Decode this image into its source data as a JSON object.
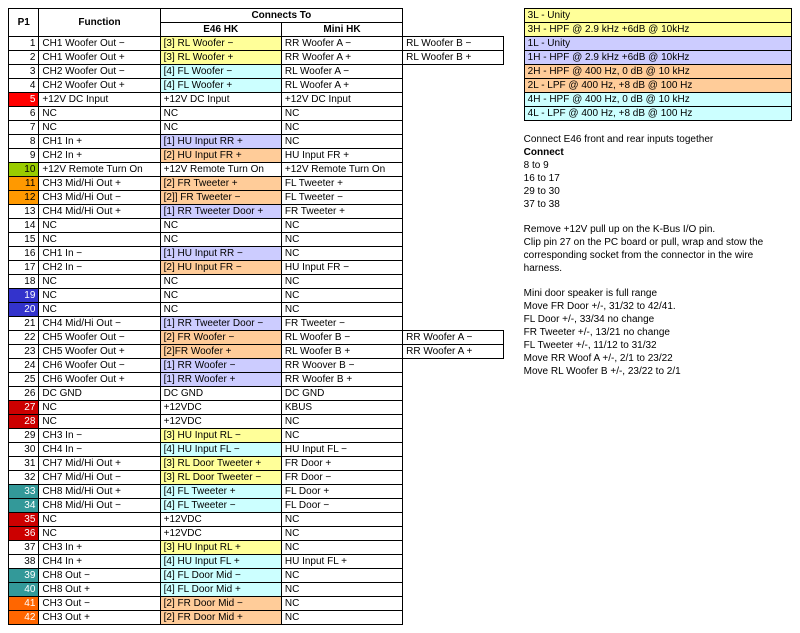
{
  "headers": {
    "p1": "P1",
    "fn": "Function",
    "ct": "Connects To",
    "e46": "E46 HK",
    "mini": "Mini HK"
  },
  "rows": [
    {
      "n": "1",
      "nc": "c-none",
      "fn": "CH1 Woofer Out −",
      "e46": "[3] RL Woofer −",
      "e46c": "c-yel",
      "mini": "RR Woofer A −",
      "ex": "RL Woofer B −"
    },
    {
      "n": "2",
      "nc": "c-none",
      "fn": "CH1 Woofer Out +",
      "e46": "[3] RL Woofer +",
      "e46c": "c-yel",
      "mini": "RR Woofer A +",
      "ex": "RL Woofer B +"
    },
    {
      "n": "3",
      "nc": "c-none",
      "fn": "CH2 Woofer Out −",
      "e46": "[4] FL Woofer −",
      "e46c": "c-cyan",
      "mini": "RL Woofer A −"
    },
    {
      "n": "4",
      "nc": "c-none",
      "fn": "CH2 Woofer Out +",
      "e46": "[4] FL Woofer +",
      "e46c": "c-cyan",
      "mini": "RL Woofer A +"
    },
    {
      "n": "5",
      "nc": "c-red",
      "fn": "+12V DC Input",
      "e46": "+12V DC Input",
      "mini": "+12V DC Input"
    },
    {
      "n": "6",
      "nc": "c-none",
      "fn": "NC",
      "e46": "NC",
      "mini": "NC"
    },
    {
      "n": "7",
      "nc": "c-none",
      "fn": "NC",
      "e46": "NC",
      "mini": "NC"
    },
    {
      "n": "8",
      "nc": "c-none",
      "fn": "CH1 In +",
      "e46": "[1] HU Input RR +",
      "e46c": "c-pur",
      "mini": "NC"
    },
    {
      "n": "9",
      "nc": "c-none",
      "fn": "CH2 In +",
      "e46": "[2] HU Input FR +",
      "e46c": "c-lora",
      "mini": "HU Input FR +"
    },
    {
      "n": "10",
      "nc": "c-grn",
      "fn": "+12V Remote Turn On",
      "e46": "+12V Remote Turn On",
      "mini": "+12V Remote Turn On"
    },
    {
      "n": "11",
      "nc": "c-ora",
      "fn": "CH3 Mid/Hi Out +",
      "e46": "[2] FR Tweeter +",
      "e46c": "c-lora",
      "mini": "FL Tweeter +"
    },
    {
      "n": "12",
      "nc": "c-ora",
      "fn": "CH3 Mid/Hi Out −",
      "e46": "[2]] FR Tweeter −",
      "e46c": "c-lora",
      "mini": "FL Tweeter −"
    },
    {
      "n": "13",
      "nc": "c-none",
      "fn": "CH4 Mid/Hi Out +",
      "e46": "[1] RR Tweeter Door +",
      "e46c": "c-pur",
      "mini": "FR Tweeter +"
    },
    {
      "n": "14",
      "nc": "c-none",
      "fn": "NC",
      "e46": "NC",
      "mini": "NC"
    },
    {
      "n": "15",
      "nc": "c-none",
      "fn": "NC",
      "e46": "NC",
      "mini": "NC"
    },
    {
      "n": "16",
      "nc": "c-none",
      "fn": "CH1 In −",
      "e46": "[1] HU Input RR −",
      "e46c": "c-pur",
      "mini": "NC"
    },
    {
      "n": "17",
      "nc": "c-none",
      "fn": "CH2 In −",
      "e46": "[2] HU Input FR −",
      "e46c": "c-lora",
      "mini": "HU Input FR −"
    },
    {
      "n": "18",
      "nc": "c-none",
      "fn": "NC",
      "e46": "NC",
      "mini": "NC"
    },
    {
      "n": "19",
      "nc": "c-blue",
      "fn": "NC",
      "e46": "NC",
      "mini": "NC"
    },
    {
      "n": "20",
      "nc": "c-blue",
      "fn": "NC",
      "e46": "NC",
      "mini": "NC"
    },
    {
      "n": "21",
      "nc": "c-none",
      "fn": "CH4 Mid/Hi Out −",
      "e46": "[1] RR Tweeter Door −",
      "e46c": "c-pur",
      "mini": "FR Tweeter −"
    },
    {
      "n": "22",
      "nc": "c-none",
      "fn": "CH5 Woofer Out −",
      "e46": "[2] FR Woofer −",
      "e46c": "c-lora",
      "mini": "RL Woofer B −",
      "ex": "RR Woofer A −"
    },
    {
      "n": "23",
      "nc": "c-none",
      "fn": "CH5 Woofer Out +",
      "e46": "[2]FR Woofer +",
      "e46c": "c-lora",
      "mini": "RL Woofer B +",
      "ex": "RR Woofer A +"
    },
    {
      "n": "24",
      "nc": "c-none",
      "fn": "CH6 Woofer Out −",
      "e46": "[1] RR Woofer −",
      "e46c": "c-pur",
      "mini": "RR Woover B −"
    },
    {
      "n": "25",
      "nc": "c-none",
      "fn": "CH6 Woofer Out +",
      "e46": "[1] RR Woofer +",
      "e46c": "c-pur",
      "mini": "RR Woofer B +"
    },
    {
      "n": "26",
      "nc": "c-none",
      "fn": "DC GND",
      "e46": "DC GND",
      "mini": "DC GND"
    },
    {
      "n": "27",
      "nc": "c-drd",
      "fn": "NC",
      "e46": "+12VDC",
      "mini": "KBUS"
    },
    {
      "n": "28",
      "nc": "c-drd",
      "fn": "NC",
      "e46": "+12VDC",
      "mini": "NC"
    },
    {
      "n": "29",
      "nc": "c-none",
      "fn": "CH3 In −",
      "e46": "[3] HU Input RL −",
      "e46c": "c-yel",
      "mini": "NC"
    },
    {
      "n": "30",
      "nc": "c-none",
      "fn": "CH4 In −",
      "e46": "[4] HU Input FL −",
      "e46c": "c-cyan",
      "mini": "HU Input FL −"
    },
    {
      "n": "31",
      "nc": "c-none",
      "fn": "CH7 Mid/Hi Out +",
      "e46": "[3] RL Door Tweeter +",
      "e46c": "c-yel",
      "mini": "FR Door +"
    },
    {
      "n": "32",
      "nc": "c-none",
      "fn": "CH7 Mid/Hi Out −",
      "e46": "[3] RL Door Tweeter −",
      "e46c": "c-yel",
      "mini": "FR Door −"
    },
    {
      "n": "33",
      "nc": "c-teal",
      "fn": "CH8 Mid/Hi Out +",
      "e46": "[4] FL Tweeter +",
      "e46c": "c-cyan",
      "mini": "FL Door +"
    },
    {
      "n": "34",
      "nc": "c-teal",
      "fn": "CH8 Mid/Hi Out −",
      "e46": "[4] FL Tweeter −",
      "e46c": "c-cyan",
      "mini": "FL Door −"
    },
    {
      "n": "35",
      "nc": "c-drd",
      "fn": "NC",
      "e46": "+12VDC",
      "mini": "NC"
    },
    {
      "n": "36",
      "nc": "c-drd",
      "fn": "NC",
      "e46": "+12VDC",
      "mini": "NC"
    },
    {
      "n": "37",
      "nc": "c-none",
      "fn": "CH3 In +",
      "e46": "[3] HU Input RL +",
      "e46c": "c-yel",
      "mini": "NC"
    },
    {
      "n": "38",
      "nc": "c-none",
      "fn": "CH4 In +",
      "e46": "[4] HU Input FL +",
      "e46c": "c-cyan",
      "mini": "HU Input FL +"
    },
    {
      "n": "39",
      "nc": "c-teal",
      "fn": "CH8 Out −",
      "e46": "[4] FL Door Mid −",
      "e46c": "c-cyan",
      "mini": "NC"
    },
    {
      "n": "40",
      "nc": "c-teal",
      "fn": "CH8 Out +",
      "e46": "[4] FL Door Mid +",
      "e46c": "c-cyan",
      "mini": "NC"
    },
    {
      "n": "41",
      "nc": "c-dora",
      "fn": "CH3 Out −",
      "e46": "[2] FR Door Mid −",
      "e46c": "c-lora",
      "mini": "NC"
    },
    {
      "n": "42",
      "nc": "c-dora",
      "fn": "CH3 Out +",
      "e46": "[2] FR Door Mid +",
      "e46c": "c-lora",
      "mini": "NC"
    }
  ],
  "legend": [
    {
      "k": "3L",
      "kc": "c-yel",
      "d": " - Unity"
    },
    {
      "k": "3H",
      "kc": "c-yel",
      "d": " - HPF @ 2.9 kHz +6dB @ 10kHz"
    },
    {
      "k": "1L",
      "kc": "c-pur",
      "d": " - Unity"
    },
    {
      "k": "1H",
      "kc": "c-pur",
      "d": " - HPF @ 2.9 kHz +6dB @ 10kHz"
    },
    {
      "k": "2H",
      "kc": "c-lora",
      "d": " - HPF @ 400 Hz, 0 dB @ 10 kHz"
    },
    {
      "k": "2L",
      "kc": "c-lora",
      "d": " - LPF @ 400 Hz, +8 dB @ 100 Hz"
    },
    {
      "k": "4H",
      "kc": "c-cyan",
      "d": " - HPF @ 400 Hz, 0 dB @ 10 kHz"
    },
    {
      "k": "4L",
      "kc": "c-cyan",
      "d": " - LPF @ 400 Hz, +8 dB @ 100 Hz"
    }
  ],
  "notes": {
    "l1": "Connect E46 front and rear inputs together",
    "l2": "Connect",
    "l3": "8 to 9",
    "l4": "16 to 17",
    "l5": "29 to 30",
    "l6": "37 to 38",
    "l7": "Remove +12V pull up on the K-Bus I/O pin.",
    "l8": "Clip pin 27 on the PC board or pull, wrap and stow the",
    "l9": "corresponding socket from the connector in the wire harness.",
    "l10": "Mini door speaker is full range",
    "l11": "Move FR Door +/-, 31/32 to 42/41.",
    "l12": "FL Door +/-, 33/34 no change",
    "l13": "FR Tweeter +/-, 13/21 no change",
    "l14": "FL Tweeter +/-, 11/12 to 31/32",
    "l15": "Move RR Woof A +/-, 2/1 to 23/22",
    "l16": "Move RL Woofer B +/-, 23/22 to 2/1"
  }
}
